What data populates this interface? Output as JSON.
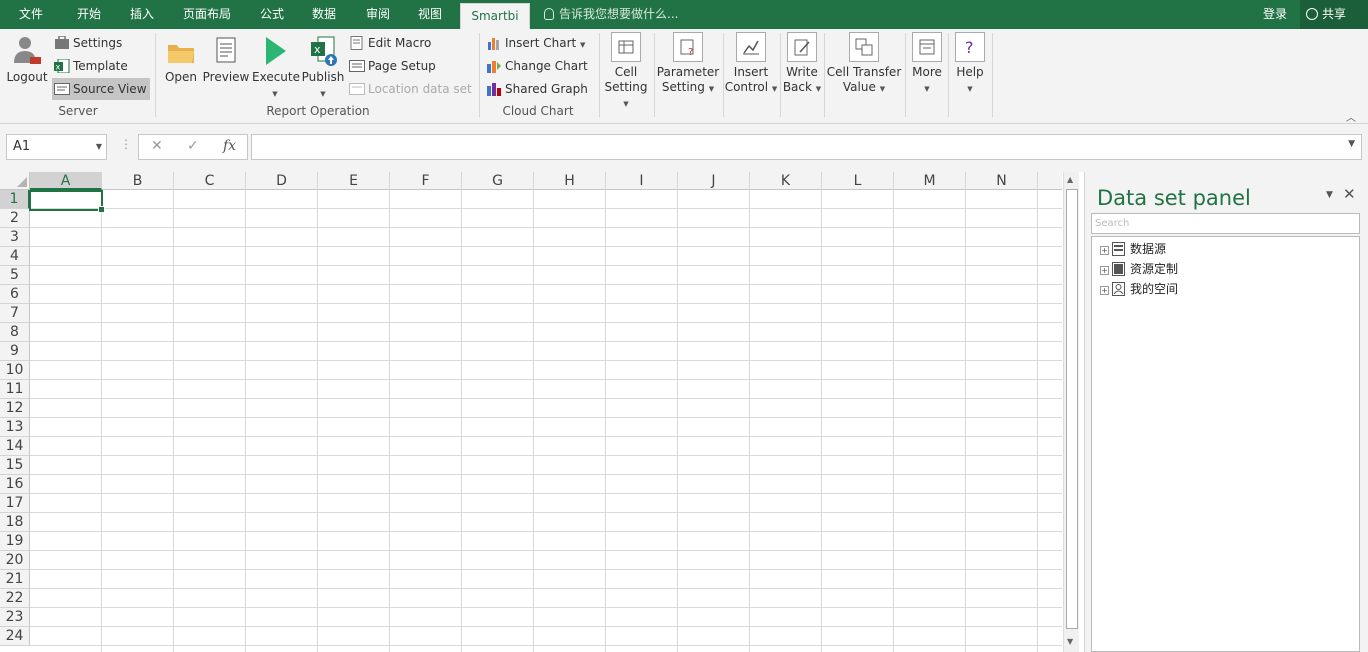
{
  "tabs": {
    "file": "文件",
    "home": "开始",
    "insert": "插入",
    "layout": "页面布局",
    "formula": "公式",
    "data": "数据",
    "review": "审阅",
    "view": "视图",
    "smartbi": "Smartbi"
  },
  "tell_me": "告诉我您想要做什么...",
  "login": "登录",
  "share": "共享",
  "ribbon": {
    "server": {
      "label": "Server",
      "logout": "Logout",
      "settings": "Settings",
      "template": "Template",
      "source_view": "Source View"
    },
    "report": {
      "label": "Report Operation",
      "open": "Open",
      "preview": "Preview",
      "execute": "Execute",
      "publish": "Publish",
      "edit_macro": "Edit Macro",
      "page_setup": "Page Setup",
      "location": "Location data set"
    },
    "cloud": {
      "label": "Cloud Chart",
      "insert_chart": "Insert Chart",
      "change_chart": "Change Chart",
      "shared_graph": "Shared Graph"
    },
    "cell_setting": [
      "Cell",
      "Setting"
    ],
    "parameter_setting": [
      "Parameter",
      "Setting"
    ],
    "insert_control": [
      "Insert",
      "Control"
    ],
    "write_back": [
      "Write",
      "Back"
    ],
    "cell_transfer": [
      "Cell Transfer",
      "Value"
    ],
    "more": "More",
    "help": "Help"
  },
  "formula_bar": {
    "name_box": "A1",
    "fx": "fx",
    "value": ""
  },
  "grid": {
    "columns": [
      "A",
      "B",
      "C",
      "D",
      "E",
      "F",
      "G",
      "H",
      "I",
      "J",
      "K",
      "L",
      "M",
      "N"
    ],
    "rows": [
      "1",
      "2",
      "3",
      "4",
      "5",
      "6",
      "7",
      "8",
      "9",
      "10",
      "11",
      "12",
      "13",
      "14",
      "15",
      "16",
      "17",
      "18",
      "19",
      "20",
      "21",
      "22",
      "23",
      "24"
    ],
    "active_cell": "A1"
  },
  "panel": {
    "title": "Data set panel",
    "search_placeholder": "Search",
    "tree": [
      "数据源",
      "资源定制",
      "我的空间"
    ]
  },
  "colors": {
    "accent": "#217346",
    "ribbon_bg": "#f3f3f3"
  }
}
